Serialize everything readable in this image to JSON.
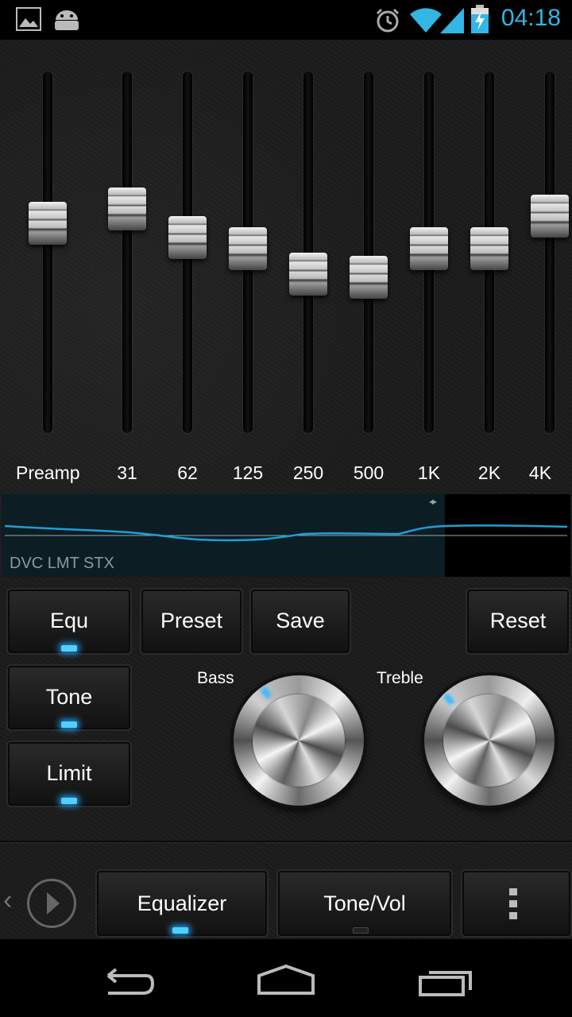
{
  "status_bar": {
    "time": "04:18",
    "left_icons": [
      "image-icon",
      "android-icon"
    ],
    "right_icons": [
      "alarm-icon",
      "wifi-icon",
      "signal-icon",
      "battery-charging-icon"
    ],
    "accent": "#33b5e5"
  },
  "equalizer": {
    "bands": [
      {
        "label": "Preamp",
        "level": 0.58
      },
      {
        "label": "31",
        "level": 0.62
      },
      {
        "label": "62",
        "level": 0.54
      },
      {
        "label": "125",
        "level": 0.51
      },
      {
        "label": "250",
        "level": 0.44
      },
      {
        "label": "500",
        "level": 0.43
      },
      {
        "label": "1K",
        "level": 0.51
      },
      {
        "label": "2K",
        "level": 0.51
      },
      {
        "label": "4K",
        "level": 0.6
      }
    ]
  },
  "curve": {
    "status_text": "DVC LMT STX",
    "line_color": "#1f9fd6"
  },
  "buttons": {
    "equ": "Equ",
    "preset": "Preset",
    "save": "Save",
    "reset": "Reset",
    "tone": "Tone",
    "limit": "Limit"
  },
  "knobs": {
    "bass_label": "Bass",
    "treble_label": "Treble"
  },
  "tabs": {
    "equalizer": "Equalizer",
    "tone_vol": "Tone/Vol",
    "prev_arrow": "‹"
  },
  "colors": {
    "led_on": "#4fd0ff",
    "background": "#1a1a1a"
  }
}
